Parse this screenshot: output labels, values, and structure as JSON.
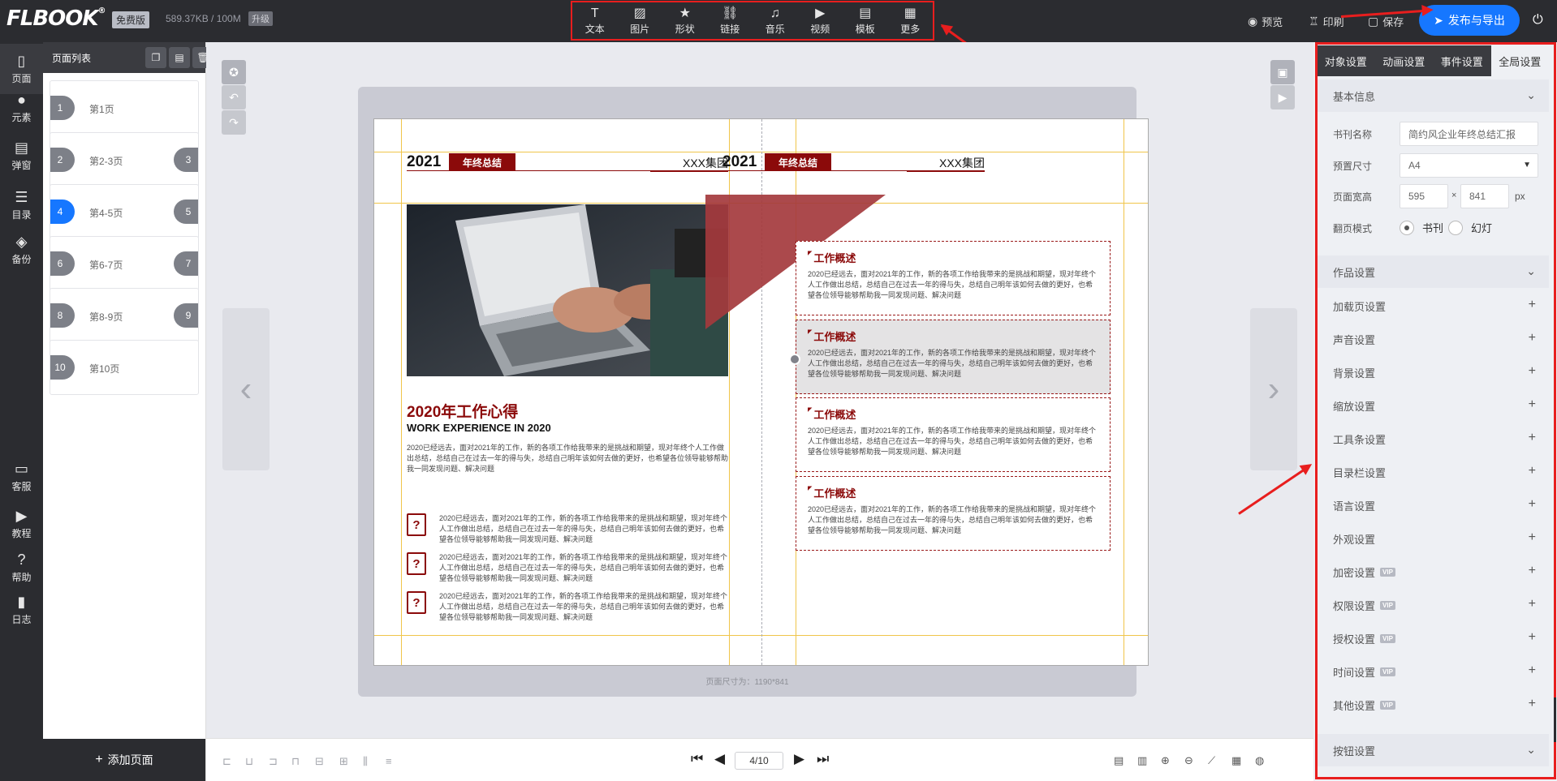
{
  "header": {
    "logo": "FLBOOK",
    "logo_reg": "®",
    "plan_badge": "免费版",
    "storage": "589.37KB / 100M",
    "upgrade": "升级"
  },
  "toolbar": [
    {
      "label": "文本",
      "icon": "text-icon",
      "glyph": "T"
    },
    {
      "label": "图片",
      "icon": "image-icon",
      "glyph": "▨"
    },
    {
      "label": "形状",
      "icon": "star-icon",
      "glyph": "★"
    },
    {
      "label": "链接",
      "icon": "link-icon",
      "glyph": "⛓"
    },
    {
      "label": "音乐",
      "icon": "music-icon",
      "glyph": "♫"
    },
    {
      "label": "视频",
      "icon": "play-circle-icon",
      "glyph": "▶"
    },
    {
      "label": "模板",
      "icon": "template-icon",
      "glyph": "▤"
    },
    {
      "label": "更多",
      "icon": "more-grid-icon",
      "glyph": "▦"
    }
  ],
  "top_actions": {
    "preview": "预览",
    "print": "印刷",
    "save": "保存",
    "publish": "发布与导出"
  },
  "leftnav": [
    {
      "label": "页面",
      "icon": "page-icon",
      "glyph": "▯"
    },
    {
      "label": "元素",
      "icon": "elements-icon",
      "glyph": "●"
    },
    {
      "label": "弹窗",
      "icon": "popup-icon",
      "glyph": "▤"
    },
    {
      "label": "目录",
      "icon": "toc-icon",
      "glyph": "☰"
    },
    {
      "label": "备份",
      "icon": "backup-icon",
      "glyph": "◈"
    },
    {
      "label": "客服",
      "icon": "chat-icon",
      "glyph": "▭"
    },
    {
      "label": "教程",
      "icon": "tutorial-icon",
      "glyph": "▶"
    },
    {
      "label": "帮助",
      "icon": "help-icon",
      "glyph": "?"
    },
    {
      "label": "日志",
      "icon": "log-icon",
      "glyph": "▮"
    }
  ],
  "pagelist": {
    "title": "页面列表",
    "pages": [
      {
        "left": "1",
        "right": "",
        "name": "第1页",
        "active": false
      },
      {
        "left": "2",
        "right": "3",
        "name": "第2-3页",
        "active": false
      },
      {
        "left": "4",
        "right": "5",
        "name": "第4-5页",
        "active": true
      },
      {
        "left": "6",
        "right": "7",
        "name": "第6-7页",
        "active": false
      },
      {
        "left": "8",
        "right": "9",
        "name": "第8-9页",
        "active": false
      },
      {
        "left": "10",
        "right": "",
        "name": "第10页",
        "active": false
      }
    ],
    "add_page": "添加页面"
  },
  "canvas": {
    "page_size_label": "页面尺寸为：1190*841",
    "left_page": {
      "year": "2021",
      "tag": "年终总结",
      "group": "XXX集团",
      "title_cn": "2020年工作心得",
      "title_en": "WORK EXPERIENCE IN 2020",
      "para": "2020已经远去，面对2021年的工作，新的各项工作给我带来的是挑战和期望，现对年终个人工作做出总结，总结自己在过去一年的得与失，总结自己明年该如何去做的更好，也希望各位领导能够帮助我一同发现问题、解决问题",
      "items": [
        "2020已经远去，面对2021年的工作，新的各项工作给我带来的是挑战和期望，现对年终个人工作做出总结，总结自己在过去一年的得与失，总结自己明年该如何去做的更好，也希望各位领导能够帮助我一同发现问题、解决问题",
        "2020已经远去，面对2021年的工作，新的各项工作给我带来的是挑战和期望，现对年终个人工作做出总结，总结自己在过去一年的得与失，总结自己明年该如何去做的更好，也希望各位领导能够帮助我一同发现问题、解决问题",
        "2020已经远去，面对2021年的工作，新的各项工作给我带来的是挑战和期望，现对年终个人工作做出总结，总结自己在过去一年的得与失，总结自己明年该如何去做的更好，也希望各位领导能够帮助我一同发现问题、解决问题"
      ]
    },
    "right_page": {
      "year": "2021",
      "tag": "年终总结",
      "group": "XXX集团",
      "boxes": [
        {
          "title": "工作概述",
          "text": "2020已经远去，面对2021年的工作，新的各项工作给我带来的是挑战和期望，现对年终个人工作做出总结，总结自己在过去一年的得与失，总结自己明年该如何去做的更好，也希望各位领导能够帮助我一同发现问题、解决问题"
        },
        {
          "title": "工作概述",
          "text": "2020已经远去，面对2021年的工作，新的各项工作给我带来的是挑战和期望，现对年终个人工作做出总结，总结自己在过去一年的得与失，总结自己明年该如何去做的更好，也希望各位领导能够帮助我一同发现问题、解决问题"
        },
        {
          "title": "工作概述",
          "text": "2020已经远去，面对2021年的工作，新的各项工作给我带来的是挑战和期望，现对年终个人工作做出总结，总结自己在过去一年的得与失，总结自己明年该如何去做的更好，也希望各位领导能够帮助我一同发现问题、解决问题"
        },
        {
          "title": "工作概述",
          "text": "2020已经远去，面对2021年的工作，新的各项工作给我带来的是挑战和期望，现对年终个人工作做出总结，总结自己在过去一年的得与失，总结自己明年该如何去做的更好，也希望各位领导能够帮助我一同发现问题、解决问题"
        }
      ]
    }
  },
  "bottombar": {
    "page_indicator": "4/10"
  },
  "rightpanel": {
    "tabs": [
      "对象设置",
      "动画设置",
      "事件设置",
      "全局设置"
    ],
    "active_tab": 3,
    "basic_info": {
      "title": "基本信息",
      "book_name_label": "书刊名称",
      "book_name_value": "简约风企业年终总结汇报",
      "preset_size_label": "预置尺寸",
      "preset_size_value": "A4",
      "page_wh_label": "页面宽高",
      "width": "595",
      "x": "×",
      "height": "841",
      "unit": "px",
      "flip_mode_label": "翻页模式",
      "flip_book": "书刊",
      "flip_slide": "幻灯"
    },
    "work_settings": {
      "title": "作品设置",
      "rows": [
        {
          "label": "加载页设置",
          "vip": false
        },
        {
          "label": "声音设置",
          "vip": false
        },
        {
          "label": "背景设置",
          "vip": false
        },
        {
          "label": "缩放设置",
          "vip": false
        },
        {
          "label": "工具条设置",
          "vip": false
        },
        {
          "label": "目录栏设置",
          "vip": false
        },
        {
          "label": "语言设置",
          "vip": false
        },
        {
          "label": "外观设置",
          "vip": false
        },
        {
          "label": "加密设置",
          "vip": true
        },
        {
          "label": "权限设置",
          "vip": true
        },
        {
          "label": "授权设置",
          "vip": true
        },
        {
          "label": "时间设置",
          "vip": true
        },
        {
          "label": "其他设置",
          "vip": true
        }
      ],
      "vip_label": "VIP"
    },
    "button_settings": {
      "title": "按钮设置"
    }
  },
  "colors": {
    "accent": "#1677ff",
    "brand_red": "#8b0a0a",
    "annotation_red": "#e81e1e",
    "dark_bar": "#2b2c30"
  }
}
